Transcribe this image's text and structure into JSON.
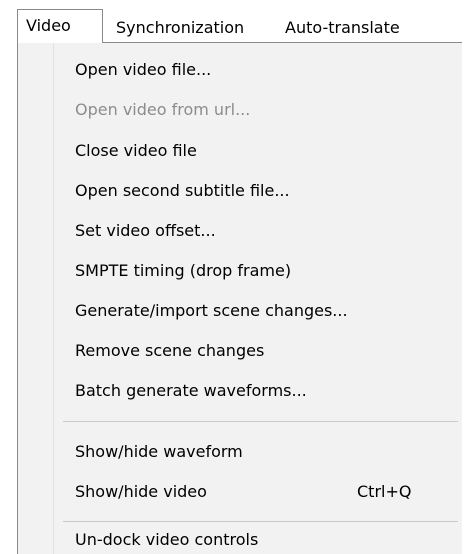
{
  "menubar": {
    "items": [
      {
        "label": "Video",
        "state": "open"
      },
      {
        "label": "Synchronization"
      },
      {
        "label": "Auto-translate"
      }
    ]
  },
  "video_menu": {
    "items": [
      {
        "label": "Open video file...",
        "enabled": true
      },
      {
        "label": "Open video from url...",
        "enabled": false
      },
      {
        "label": "Close video file",
        "enabled": true
      },
      {
        "label": "Open second subtitle file...",
        "enabled": true
      },
      {
        "label": "Set video offset...",
        "enabled": true
      },
      {
        "label": "SMPTE timing (drop frame)",
        "enabled": true
      },
      {
        "label": "Generate/import scene changes...",
        "enabled": true
      },
      {
        "label": "Remove scene changes",
        "enabled": true
      },
      {
        "label": "Batch generate waveforms...",
        "enabled": true
      },
      {
        "label": "Show/hide waveform",
        "enabled": true
      },
      {
        "label": "Show/hide video",
        "shortcut": "Ctrl+Q",
        "enabled": true
      },
      {
        "label": "Un-dock video controls",
        "enabled": true
      }
    ]
  },
  "colors": {
    "menu_background": "#f2f2f2",
    "disabled_text": "#8c8c8c",
    "border": "#8a8a8a"
  }
}
